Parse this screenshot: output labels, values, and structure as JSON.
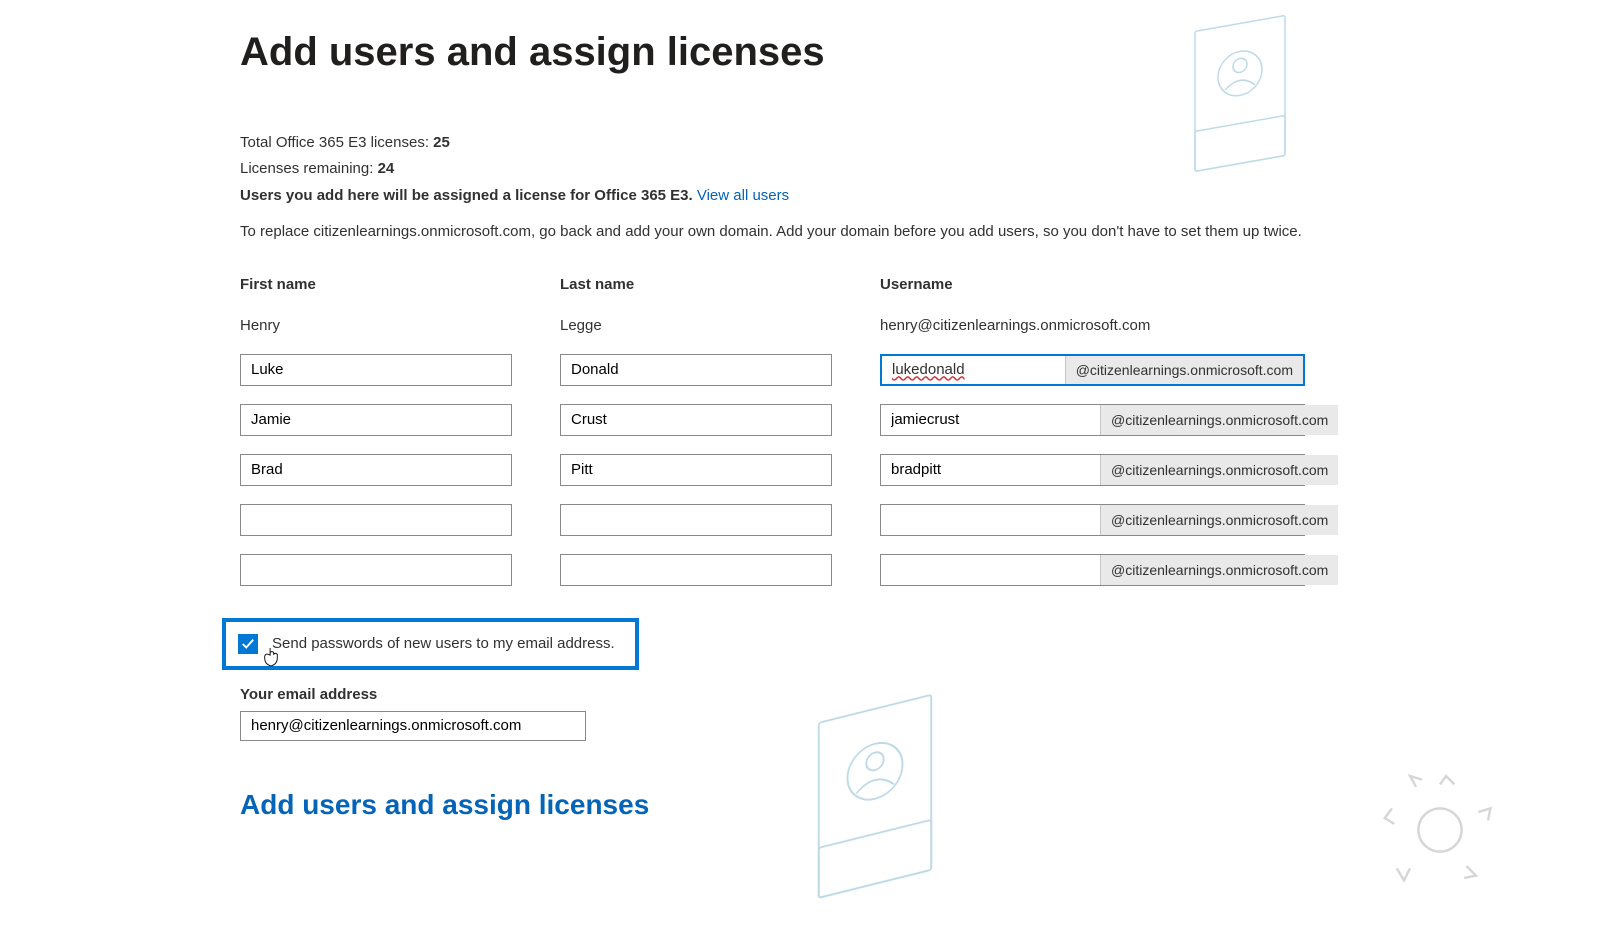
{
  "page": {
    "title": "Add users and assign licenses",
    "total_label": "Total Office 365 E3 licenses: ",
    "total_value": "25",
    "remaining_label": "Licenses remaining: ",
    "remaining_value": "24",
    "assign_note": "Users you add here will be assigned a license for Office 365 E3. ",
    "view_all_link": "View all users",
    "replace_note": "To replace citizenlearnings.onmicrosoft.com, go back and add your own domain. Add your domain before you add users, so you don't have to set them up twice."
  },
  "columns": {
    "first": "First name",
    "last": "Last name",
    "user": "Username"
  },
  "existing": {
    "first": "Henry",
    "last": "Legge",
    "user": "henry@citizenlearnings.onmicrosoft.com"
  },
  "domain_suffix": "@citizenlearnings.onmicrosoft.com",
  "rows": [
    {
      "first": "Luke",
      "last": "Donald",
      "user": "lukedonald",
      "focused": true,
      "spelling": true
    },
    {
      "first": "Jamie",
      "last": "Crust",
      "user": "jamiecrust"
    },
    {
      "first": "Brad",
      "last": "Pitt",
      "user": "bradpitt"
    },
    {
      "first": "",
      "last": "",
      "user": ""
    },
    {
      "first": "",
      "last": "",
      "user": ""
    }
  ],
  "send_pw": {
    "checked": true,
    "label": "Send passwords of new users to my email address."
  },
  "email": {
    "label": "Your email address",
    "value": "henry@citizenlearnings.onmicrosoft.com"
  },
  "section_title": "Add users and assign licenses"
}
